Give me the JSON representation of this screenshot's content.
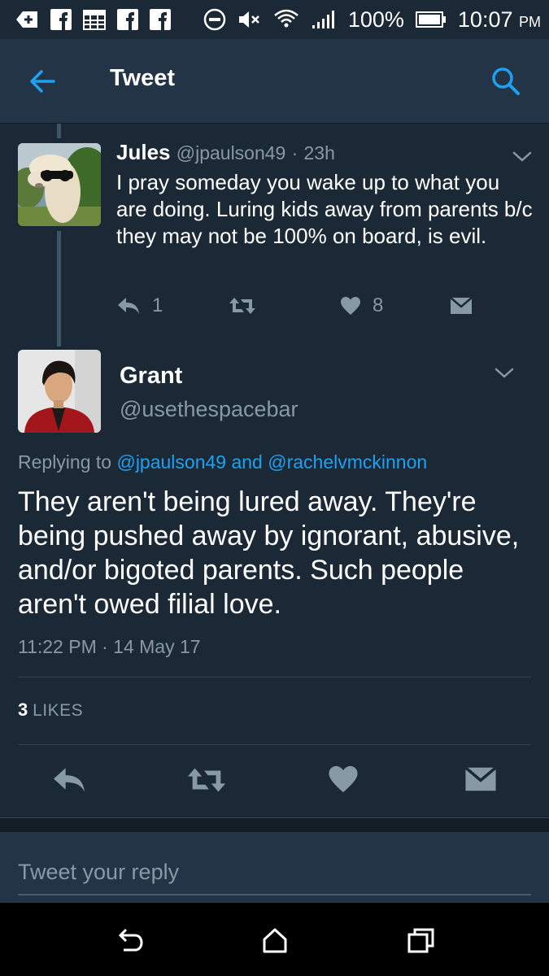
{
  "status_bar": {
    "battery": "100%",
    "time": "10:07",
    "ampm": "PM"
  },
  "header": {
    "title": "Tweet"
  },
  "reply_tweet": {
    "name": "Jules",
    "handle": "@jpaulson49",
    "separator": "·",
    "time": "23h",
    "text": "I pray someday you wake up to what you are doing. Luring kids away from parents b/c they may not be 100% on board, is evil.",
    "reply_count": "1",
    "like_count": "8"
  },
  "main_tweet": {
    "name": "Grant",
    "handle": "@usethespacebar",
    "replying_prefix": "Replying to",
    "replying_user1": "@jpaulson49",
    "replying_and": "and",
    "replying_user2": "@rachelvmckinnon",
    "text": "They aren't being lured away. They're being pushed away by ignorant, abusive, and/or bigoted parents. Such people aren't owed filial love.",
    "timestamp": "11:22 PM · 14 May 17",
    "likes_count": "3",
    "likes_label": "LIKES"
  },
  "reply_box": {
    "placeholder": "Tweet your reply"
  },
  "colors": {
    "background": "#1b2836",
    "header": "#243447",
    "accent": "#1da1f2",
    "secondary_text": "#8899a6"
  },
  "icons": {
    "back": "arrow-left-icon",
    "search": "search-icon",
    "reply": "reply-icon",
    "retweet": "retweet-icon",
    "like": "heart-icon",
    "dm": "envelope-icon"
  }
}
